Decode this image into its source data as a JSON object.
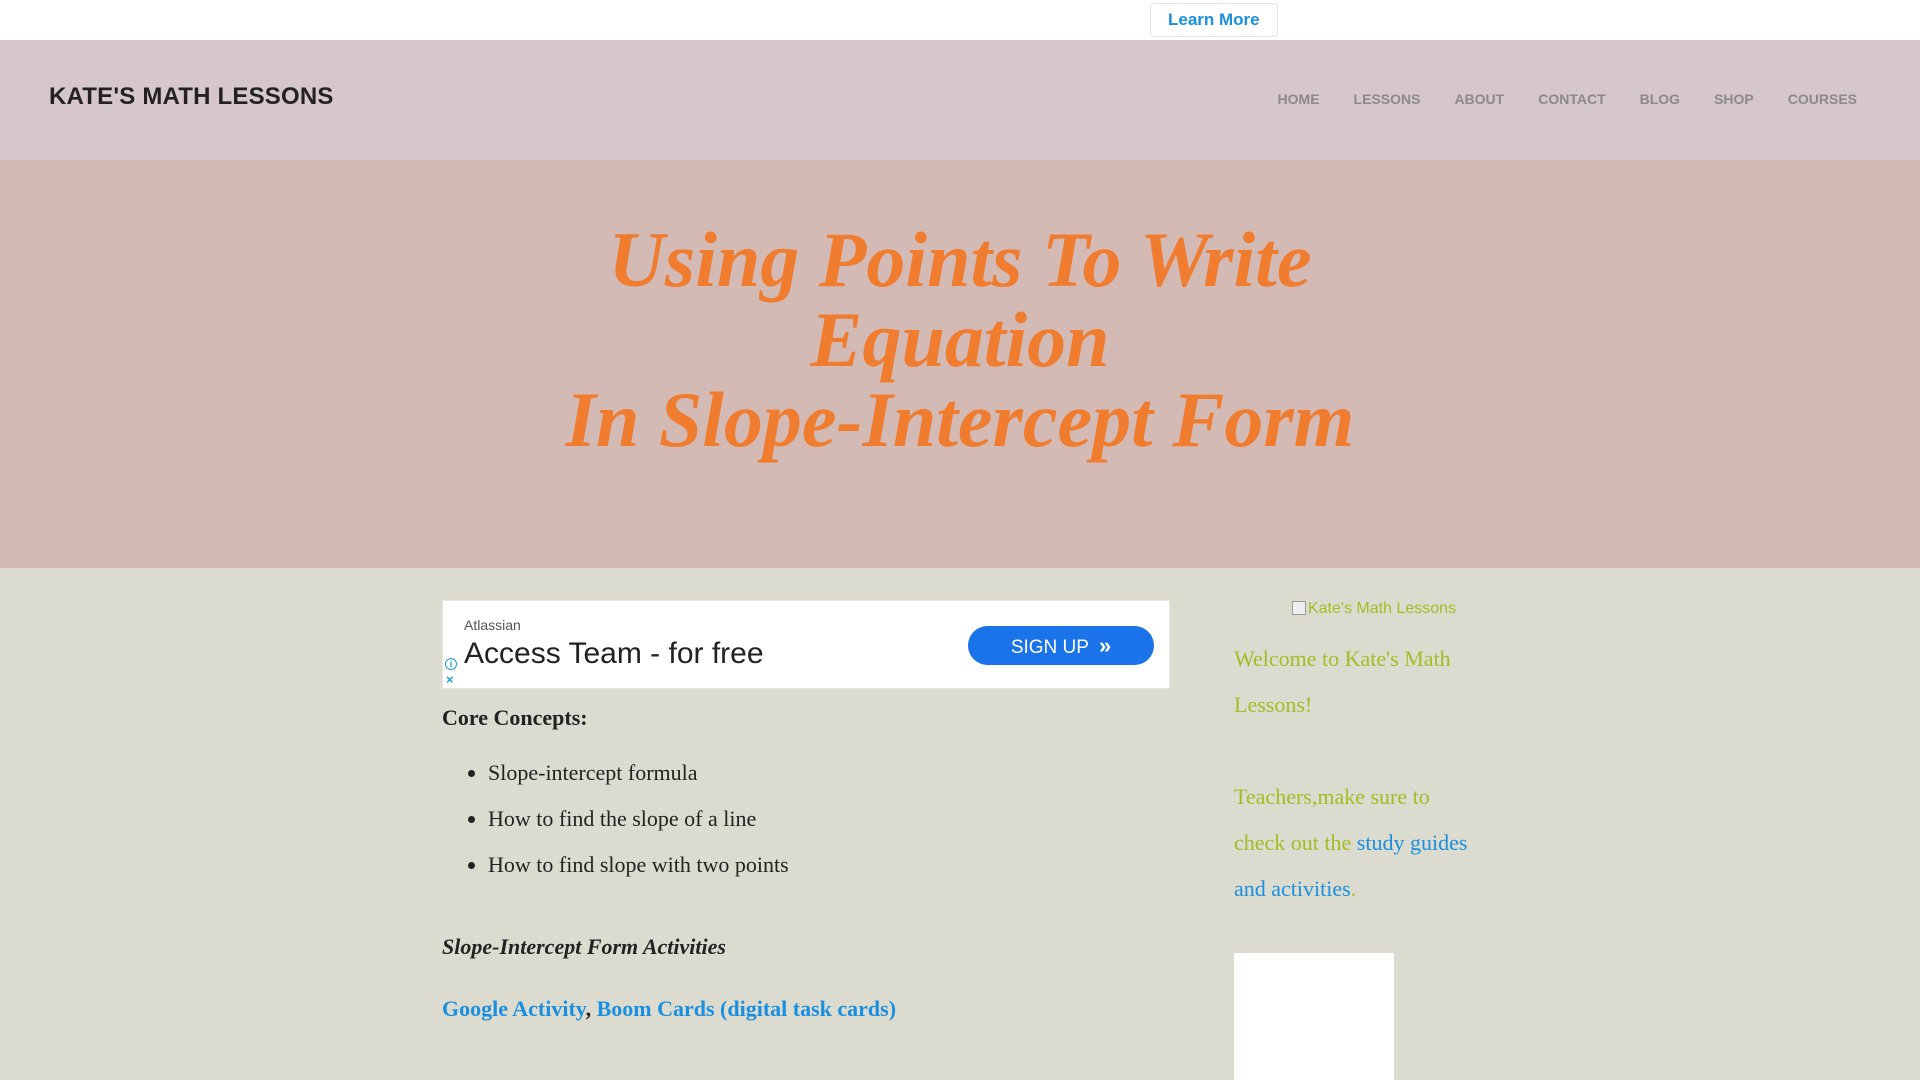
{
  "topbar": {
    "learn_more": "Learn More"
  },
  "header": {
    "site_title": "KATE'S MATH LESSONS",
    "nav": [
      "HOME",
      "LESSONS",
      "ABOUT",
      "CONTACT",
      "BLOG",
      "SHOP",
      "COURSES"
    ]
  },
  "hero": {
    "title_line1": "Using Points To Write",
    "title_line2": "Equation",
    "title_line3": "In Slope-Intercept Form"
  },
  "ad": {
    "sponsor": "Atlassian",
    "headline": "Access Team - for free",
    "cta": "SIGN UP",
    "info_icon": "i",
    "close_icon": "×"
  },
  "main": {
    "core_heading": "Core Concepts:",
    "concepts": [
      "Slope-intercept formula",
      "How to find the slope of a line",
      "How to find slope with two points"
    ],
    "activities_heading": "Slope-Intercept Form Activities",
    "link_google": "Google Activity",
    "separator": ",",
    "link_boom": "Boom Cards (digital task cards)"
  },
  "sidebar": {
    "logo_alt": "Kate's Math Lessons",
    "welcome": "Welcome to Kate's Math Lessons!",
    "teachers_prefix": "Teachers,make sure to check out the ",
    "teachers_link": "study guides and activities",
    "teachers_suffix": "."
  },
  "colors": {
    "accent_orange": "#f07c30",
    "link_blue": "#1a8fe0",
    "sidebar_green": "#a3bd25",
    "header_bg": "#d6c7cc",
    "hero_bg": "#d3bab5"
  }
}
